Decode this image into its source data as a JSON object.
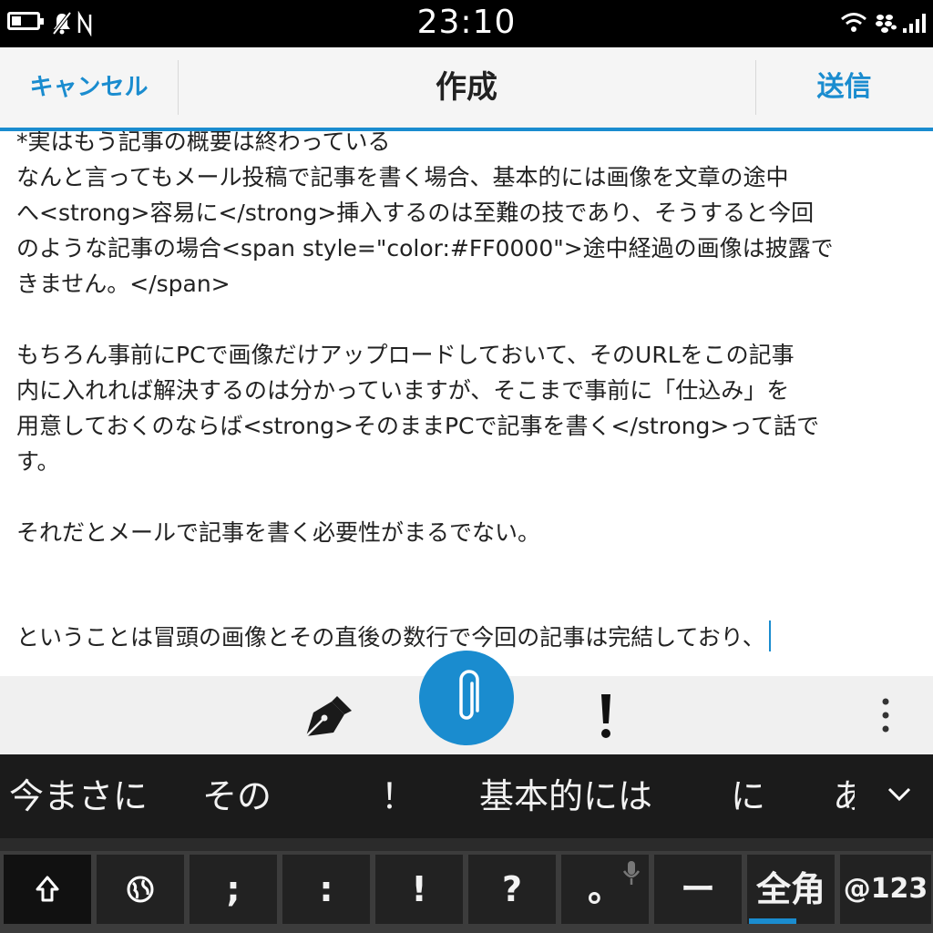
{
  "status_bar": {
    "time": "23:10"
  },
  "title_bar": {
    "cancel": "キャンセル",
    "title": "作成",
    "send": "送信"
  },
  "body_lines": [
    "*実はもう記事の概要は終わっている",
    "なんと言ってもメール投稿で記事を書く場合、基本的には画像を文章の途中",
    "へ<strong>容易に</strong>挿入するのは至難の技であり、そうすると今回",
    "のような記事の場合<span style=\"color:#FF0000\">途中経過の画像は披露で",
    "きません。</span>",
    "",
    "もちろん事前にPCで画像だけアップロードしておいて、そのURLをこの記事",
    "内に入れれば解決するのは分かっていますが、そこまで事前に「仕込み」を",
    "用意しておくのならば<strong>そのままPCで記事を書く</strong>って話で",
    "す。",
    "",
    "それだとメールで記事を書く必要性がまるでない。",
    "",
    "",
    "ということは冒頭の画像とその直後の数行で今回の記事は完結しており、"
  ],
  "candidates": [
    "今まさに",
    "その",
    "！",
    "基本的には",
    "に",
    "ありが"
  ],
  "keys": [
    ";",
    ":",
    "!",
    "?",
    "。",
    "ー",
    "全角",
    "@123"
  ],
  "colors": {
    "accent": "#1a8ccf",
    "status_bg": "#000000",
    "candidate_bg": "#1b1b1b",
    "key_bg": "#222222"
  },
  "icons": {
    "status": [
      "battery-icon",
      "silent-icon",
      "nfc-icon",
      "wifi-icon",
      "blackberry-icon",
      "signal-icon"
    ],
    "actions": [
      "pen-icon",
      "attachment-icon",
      "priority-icon",
      "more-icon"
    ],
    "keyboard": [
      "shift-icon",
      "globe-icon",
      "mic-icon"
    ]
  }
}
